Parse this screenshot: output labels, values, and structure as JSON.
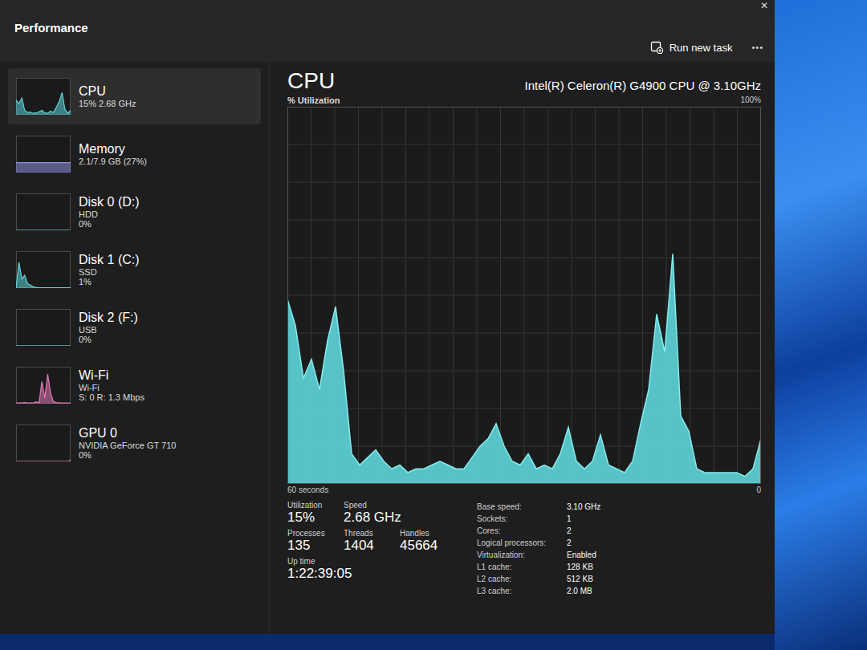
{
  "window": {
    "title": "Performance",
    "close": "✕"
  },
  "toolbar": {
    "run_new_task": "Run new task",
    "more": "•••"
  },
  "sidebar": {
    "items": [
      {
        "name": "CPU",
        "lines": [
          "15% 2.68 GHz"
        ],
        "selected": true,
        "color": "#5fd6da",
        "values": [
          40,
          30,
          45,
          12,
          6,
          7,
          4,
          5,
          8,
          12,
          5,
          4,
          10,
          6,
          20,
          35,
          60,
          15,
          4,
          12
        ]
      },
      {
        "name": "Memory",
        "lines": [
          "2.1/7.9 GB (27%)"
        ],
        "selected": false,
        "color": "#8f8fe0",
        "values": [
          27,
          27,
          27,
          27,
          27,
          27,
          27,
          27,
          27,
          27,
          27,
          27,
          27,
          27,
          27,
          27,
          27,
          27,
          27,
          27
        ]
      },
      {
        "name": "Disk 0 (D:)",
        "lines": [
          "HDD",
          "0%"
        ],
        "selected": false,
        "color": "#5fd6da",
        "values": [
          0,
          0,
          0,
          0,
          0,
          0,
          0,
          0,
          0,
          0,
          0,
          0,
          0,
          0,
          0,
          0,
          0,
          0,
          0,
          0
        ]
      },
      {
        "name": "Disk 1 (C:)",
        "lines": [
          "SSD",
          "1%"
        ],
        "selected": false,
        "color": "#5fd6da",
        "values": [
          0,
          70,
          25,
          35,
          12,
          8,
          3,
          2,
          1,
          1,
          1,
          1,
          1,
          1,
          1,
          1,
          1,
          1,
          1,
          1
        ]
      },
      {
        "name": "Disk 2 (F:)",
        "lines": [
          "USB",
          "0%"
        ],
        "selected": false,
        "color": "#5fd6da",
        "values": [
          0,
          0,
          0,
          0,
          0,
          0,
          0,
          0,
          0,
          0,
          0,
          0,
          0,
          0,
          0,
          0,
          0,
          0,
          0,
          0
        ]
      },
      {
        "name": "Wi-Fi",
        "lines": [
          "Wi-Fi",
          "S: 0 R: 1.3 Mbps"
        ],
        "selected": false,
        "color": "#e07ab8",
        "values": [
          2,
          2,
          2,
          3,
          2,
          2,
          2,
          5,
          2,
          60,
          15,
          80,
          30,
          5,
          3,
          2,
          2,
          2,
          2,
          2
        ]
      },
      {
        "name": "GPU 0",
        "lines": [
          "NVIDIA GeForce GT 710",
          "0%"
        ],
        "selected": false,
        "color": "#e07ab8",
        "values": [
          0,
          0,
          0,
          0,
          0,
          0,
          0,
          0,
          0,
          0,
          0,
          0,
          0,
          0,
          0,
          0,
          0,
          0,
          0,
          4
        ]
      }
    ]
  },
  "main": {
    "title": "CPU",
    "device": "Intel(R) Celeron(R) G4900 CPU @ 3.10GHz",
    "y_label": "% Utilization",
    "y_max": "100%",
    "x_start": "60 seconds",
    "x_end": "0",
    "series": [
      49,
      42,
      28,
      33,
      25,
      38,
      47,
      30,
      8,
      5,
      7,
      9,
      6,
      4,
      5,
      3,
      4,
      4,
      5,
      6,
      5,
      4,
      4,
      7,
      10,
      12,
      16,
      10,
      6,
      5,
      8,
      4,
      5,
      4,
      8,
      15,
      6,
      4,
      6,
      13,
      5,
      4,
      3,
      6,
      16,
      25,
      45,
      35,
      61,
      18,
      14,
      4,
      3,
      3,
      3,
      3,
      3,
      2,
      4,
      12
    ]
  },
  "stat_rows": [
    [
      {
        "label": "Utilization",
        "value": "15%"
      },
      {
        "label": "Speed",
        "value": "2.68 GHz"
      }
    ],
    [
      {
        "label": "Processes",
        "value": "135"
      },
      {
        "label": "Threads",
        "value": "1404"
      },
      {
        "label": "Handles",
        "value": "45664"
      }
    ],
    [
      {
        "label": "Up time",
        "value": "1:22:39:05"
      }
    ]
  ],
  "details": [
    {
      "label": "Base speed:",
      "value": "3.10 GHz"
    },
    {
      "label": "Sockets:",
      "value": "1"
    },
    {
      "label": "Cores:",
      "value": "2"
    },
    {
      "label": "Logical processors:",
      "value": "2"
    },
    {
      "label": "Virtualization:",
      "value": "Enabled"
    },
    {
      "label": "L1 cache:",
      "value": "128 KB"
    },
    {
      "label": "L2 cache:",
      "value": "512 KB"
    },
    {
      "label": "L3 cache:",
      "value": "2.0 MB"
    }
  ]
}
